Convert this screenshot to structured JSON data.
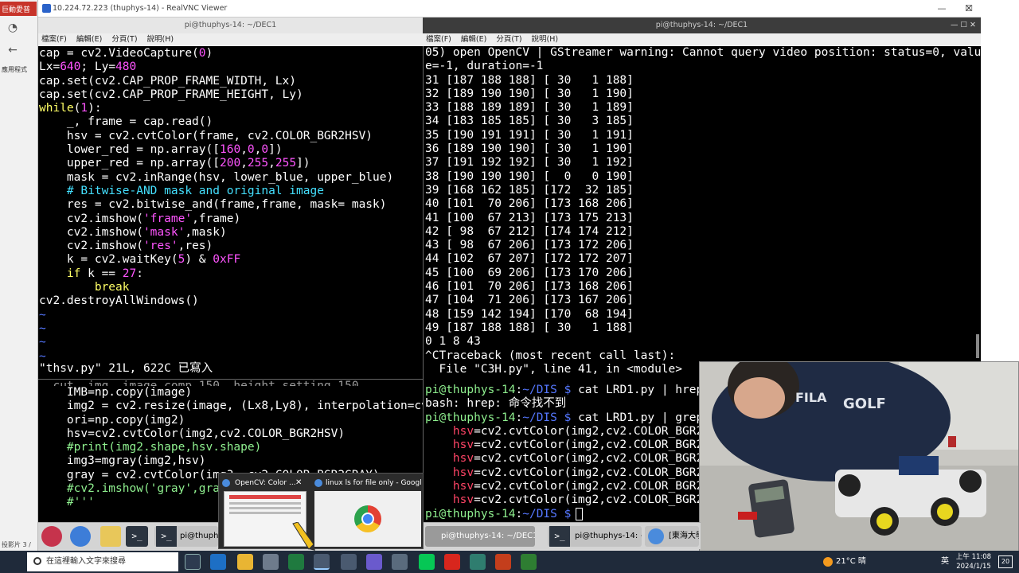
{
  "host": {
    "tab_label": "巨動愛普",
    "bookmark": "應用程式",
    "status": "投影片 3 /"
  },
  "vnc": {
    "title": "10.224.72.223 (thuphys-14) - RealVNC Viewer",
    "min": "—",
    "max": "☐",
    "close": "✕"
  },
  "term_left": {
    "title": "pi@thuphys-14: ~/DEC1",
    "menu": [
      "檔案(F)",
      "編輯(E)",
      "分頁(T)",
      "說明(H)"
    ]
  },
  "term_right": {
    "title": "pi@thuphys-14: ~/DEC1",
    "menu": [
      "檔案(F)",
      "編輯(E)",
      "分頁(T)",
      "說明(H)"
    ],
    "ctrl": "—  ☐  ✕"
  },
  "code_lines": [
    [
      {
        "t": "cap = cv2.VideoCapture(",
        "c": "w"
      },
      {
        "t": "0",
        "c": "m"
      },
      {
        "t": ")",
        "c": "w"
      }
    ],
    [
      {
        "t": "Lx=",
        "c": "w"
      },
      {
        "t": "640",
        "c": "m"
      },
      {
        "t": "; Ly=",
        "c": "w"
      },
      {
        "t": "480",
        "c": "m"
      }
    ],
    [
      {
        "t": "cap.set(cv2.CAP_PROP_FRAME_WIDTH, Lx)",
        "c": "w"
      }
    ],
    [
      {
        "t": "cap.set(cv2.CAP_PROP_FRAME_HEIGHT, Ly)",
        "c": "w"
      }
    ],
    [
      {
        "t": "while",
        "c": "y"
      },
      {
        "t": "(",
        "c": "w"
      },
      {
        "t": "1",
        "c": "m"
      },
      {
        "t": "):",
        "c": "w"
      }
    ],
    [
      {
        "t": "    _, frame = cap.read()",
        "c": "w"
      }
    ],
    [
      {
        "t": "    hsv = cv2.cvtColor(frame, cv2.COLOR_BGR2HSV)",
        "c": "w"
      }
    ],
    [
      {
        "t": "    lower_red = np.array([",
        "c": "w"
      },
      {
        "t": "160",
        "c": "m"
      },
      {
        "t": ",",
        "c": "w"
      },
      {
        "t": "0",
        "c": "m"
      },
      {
        "t": ",",
        "c": "w"
      },
      {
        "t": "0",
        "c": "m"
      },
      {
        "t": "])",
        "c": "w"
      }
    ],
    [
      {
        "t": "    upper_red = np.array([",
        "c": "w"
      },
      {
        "t": "200",
        "c": "m"
      },
      {
        "t": ",",
        "c": "w"
      },
      {
        "t": "255",
        "c": "m"
      },
      {
        "t": ",",
        "c": "w"
      },
      {
        "t": "255",
        "c": "m"
      },
      {
        "t": "])",
        "c": "w"
      }
    ],
    [
      {
        "t": "    mask = cv2.inRange(hsv, lower_blue, upper_blue)",
        "c": "w"
      }
    ],
    [
      {
        "t": "    # Bitwise-AND mask and original image",
        "c": "c"
      }
    ],
    [
      {
        "t": "    res = cv2.bitwise_and(frame,frame, mask= mask)",
        "c": "w"
      }
    ],
    [
      {
        "t": "    cv2.imshow(",
        "c": "w"
      },
      {
        "t": "'frame'",
        "c": "m"
      },
      {
        "t": ",frame)",
        "c": "w"
      }
    ],
    [
      {
        "t": "    cv2.imshow(",
        "c": "w"
      },
      {
        "t": "'mask'",
        "c": "m"
      },
      {
        "t": ",mask)",
        "c": "w"
      }
    ],
    [
      {
        "t": "    cv2.imshow(",
        "c": "w"
      },
      {
        "t": "'res'",
        "c": "m"
      },
      {
        "t": ",res)",
        "c": "w"
      }
    ],
    [
      {
        "t": "    k = cv2.waitKey(",
        "c": "w"
      },
      {
        "t": "5",
        "c": "m"
      },
      {
        "t": ") & ",
        "c": "w"
      },
      {
        "t": "0xFF",
        "c": "m"
      }
    ],
    [
      {
        "t": "    if",
        "c": "y"
      },
      {
        "t": " k == ",
        "c": "w"
      },
      {
        "t": "27",
        "c": "m"
      },
      {
        "t": ":",
        "c": "w"
      }
    ],
    [
      {
        "t": "        break",
        "c": "y"
      }
    ],
    [
      {
        "t": "cv2.destroyAllWindows()",
        "c": "w"
      }
    ],
    [
      {
        "t": "~",
        "c": "b"
      }
    ],
    [
      {
        "t": "~",
        "c": "b"
      }
    ],
    [
      {
        "t": "~",
        "c": "b"
      }
    ],
    [
      {
        "t": "~",
        "c": "b"
      }
    ]
  ],
  "vim_status": "\"thsv.py\" 21L, 622C 已寫入",
  "lower_left_lines": [
    [
      {
        "t": "    IMB=np.copy(image)",
        "c": "w"
      }
    ],
    [
      {
        "t": "    img2 = cv2.resize(image, (Lx8,Ly8), interpolation=cv",
        "c": "w"
      }
    ],
    [
      {
        "t": "    ori=np.copy(img2)",
        "c": "w"
      }
    ],
    [
      {
        "t": "    hsv=cv2.cvtColor(img2,cv2.COLOR_BGR2HSV)",
        "c": "w"
      }
    ],
    [
      {
        "t": "    #print(img2.shape,hsv.shape)",
        "c": "g"
      }
    ],
    [
      {
        "t": "    img3=mgray(img2,hsv)",
        "c": "w"
      }
    ],
    [
      {
        "t": "    gray = cv2.cvtColor(img3, cv2.COLOR_BGR2GRAY)",
        "c": "w"
      }
    ],
    [
      {
        "t": "    #cv2.imshow('gray',gra",
        "c": "g"
      }
    ],
    [
      {
        "t": "    #'''",
        "c": "g"
      }
    ]
  ],
  "output_lines": [
    "05) open OpenCV | GStreamer warning: Cannot query video position: status=0, valu",
    "e=-1, duration=-1",
    "31 [187 188 188] [ 30   1 188]",
    "32 [189 190 190] [ 30   1 190]",
    "33 [188 189 189] [ 30   1 189]",
    "34 [183 185 185] [ 30   3 185]",
    "35 [190 191 191] [ 30   1 191]",
    "36 [189 190 190] [ 30   1 190]",
    "37 [191 192 192] [ 30   1 192]",
    "38 [190 190 190] [  0   0 190]",
    "39 [168 162 185] [172  32 185]",
    "40 [101  70 206] [173 168 206]",
    "41 [100  67 213] [173 175 213]",
    "42 [ 98  67 212] [174 174 212]",
    "43 [ 98  67 206] [173 172 206]",
    "44 [102  67 207] [172 172 207]",
    "45 [100  69 206] [173 170 206]",
    "46 [101  70 206] [173 168 206]",
    "47 [104  71 206] [173 167 206]",
    "48 [159 142 194] [170  68 194]",
    "49 [187 188 188] [ 30   1 188]",
    "0 1 8 43",
    "^CTraceback (most recent call last):",
    "  File \"C3H.py\", line 41, in <module>"
  ],
  "shell_lines": [
    [
      {
        "t": "pi@thuphys-14",
        "c": "g"
      },
      {
        "t": ":",
        "c": "w"
      },
      {
        "t": "~/DIS $",
        "c": "b"
      },
      {
        "t": " cat LRD1.py | hrep",
        "c": "w"
      }
    ],
    [
      {
        "t": "bash: hrep: 命令找不到",
        "c": "w"
      }
    ],
    [
      {
        "t": "pi@thuphys-14",
        "c": "g"
      },
      {
        "t": ":",
        "c": "w"
      },
      {
        "t": "~/DIS $",
        "c": "b"
      },
      {
        "t": " cat LRD1.py | grep",
        "c": "w"
      }
    ],
    [
      {
        "t": "    hsv",
        "c": "r"
      },
      {
        "t": "=cv2.cvtColor(img2,cv2.COLOR_BGR2",
        "c": "w"
      }
    ],
    [
      {
        "t": "    hsv",
        "c": "r"
      },
      {
        "t": "=cv2.cvtColor(img2,cv2.COLOR_BGR2",
        "c": "w"
      }
    ],
    [
      {
        "t": "    hsv",
        "c": "r"
      },
      {
        "t": "=cv2.cvtColor(img2,cv2.COLOR_BGR2",
        "c": "w"
      }
    ],
    [
      {
        "t": "    hsv",
        "c": "r"
      },
      {
        "t": "=cv2.cvtColor(img2,cv2.COLOR_BGR2",
        "c": "w"
      }
    ],
    [
      {
        "t": "    hsv",
        "c": "r"
      },
      {
        "t": "=cv2.cvtColor(img2,cv2.COLOR_BGR2",
        "c": "w"
      }
    ],
    [
      {
        "t": "    hsv",
        "c": "r"
      },
      {
        "t": "=cv2.cvtColor(img2,cv2.COLOR_BGR2",
        "c": "w"
      }
    ],
    [
      {
        "t": "pi@thuphys-14",
        "c": "g"
      },
      {
        "t": ":",
        "c": "w"
      },
      {
        "t": "~/DIS $",
        "c": "b"
      },
      {
        "t": " ",
        "c": "w"
      }
    ]
  ],
  "pi_taskbar": {
    "term1": "pi@thuphys",
    "term2": "pi@thuphys-14: ~/DEC1",
    "term3": "pi@thuphys-14: ~/",
    "browser": "[東海大學"
  },
  "popup": {
    "item1": "OpenCV: Color ...",
    "item2": "linux ls for file only - Google ...",
    "close": "✕"
  },
  "windows": {
    "search_placeholder": "在這裡輸入文字來搜尋",
    "weather": "21°C 晴",
    "ime": "英",
    "time": "上午 11:08",
    "date": "2024/1/15",
    "notif": "20"
  },
  "colors": {
    "w": "#ffffff",
    "g": "#8ff08f",
    "m": "#ff55ff",
    "c": "#44e0ff",
    "y": "#ffff66",
    "b": "#5577ff",
    "r": "#ff4466"
  }
}
